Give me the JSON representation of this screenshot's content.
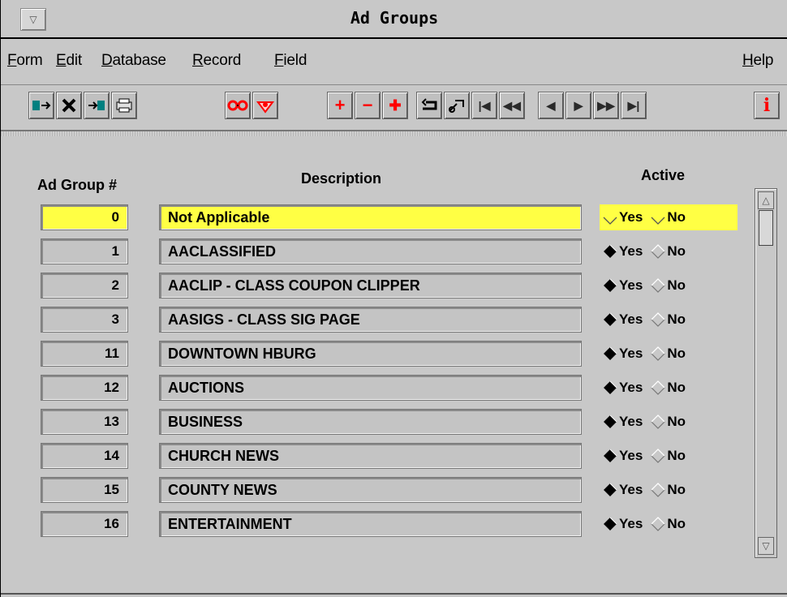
{
  "window": {
    "title": "Ad Groups",
    "sysmenu_glyph": "▽"
  },
  "menu": {
    "form": "Form",
    "edit": "Edit",
    "database": "Database",
    "record": "Record",
    "field": "Field",
    "help": "Help"
  },
  "toolbar": {
    "exit_icon": "exit-icon",
    "delete_icon": "x-icon",
    "import_icon": "import-icon",
    "print_icon": "printer-icon",
    "view_icon": "glasses-icon",
    "find_icon": "find-icon",
    "add_glyph": "+",
    "remove_glyph": "−",
    "insert_glyph": "✚",
    "first_glyph": "|◀",
    "prev_page_glyph": "◀◀",
    "prev_glyph": "◀",
    "next_glyph": "▶",
    "next_page_glyph": "▶▶",
    "last_glyph": "▶|",
    "info_glyph": "i"
  },
  "columns": {
    "group_num": "Ad Group #",
    "description": "Description",
    "active": "Active"
  },
  "radio_labels": {
    "yes": "Yes",
    "no": "No"
  },
  "rows": [
    {
      "num": "0",
      "desc": "Not Applicable",
      "active": "none",
      "selected": true
    },
    {
      "num": "1",
      "desc": "AACLASSIFIED",
      "active": "yes"
    },
    {
      "num": "2",
      "desc": "AACLIP - CLASS COUPON CLIPPER",
      "active": "yes"
    },
    {
      "num": "3",
      "desc": "AASIGS - CLASS SIG PAGE",
      "active": "yes"
    },
    {
      "num": "11",
      "desc": "DOWNTOWN HBURG",
      "active": "yes"
    },
    {
      "num": "12",
      "desc": "AUCTIONS",
      "active": "yes"
    },
    {
      "num": "13",
      "desc": "BUSINESS",
      "active": "yes"
    },
    {
      "num": "14",
      "desc": "CHURCH NEWS",
      "active": "yes"
    },
    {
      "num": "15",
      "desc": "COUNTY NEWS",
      "active": "yes"
    },
    {
      "num": "16",
      "desc": "ENTERTAINMENT",
      "active": "yes"
    }
  ],
  "colors": {
    "selection": "#ffff44",
    "window_bg": "#c8c8c8",
    "toolbar_red": "#ff0000"
  }
}
